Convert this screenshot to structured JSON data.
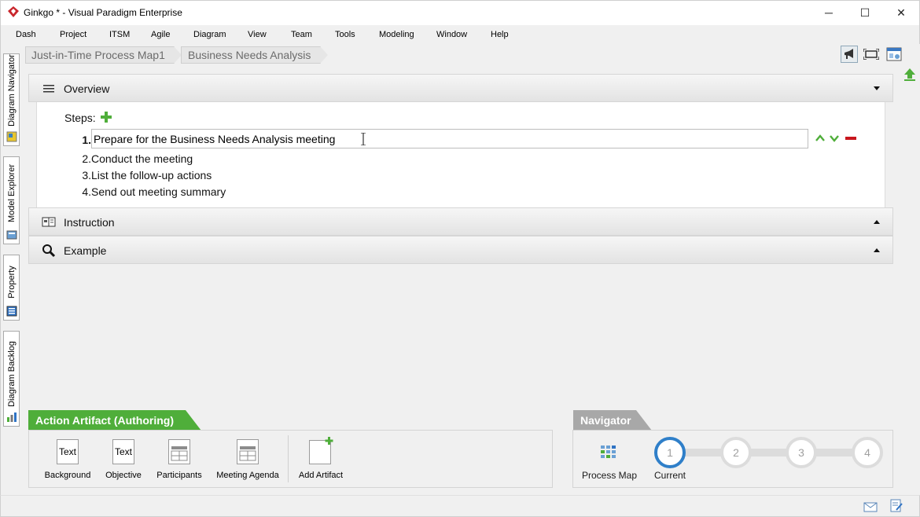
{
  "window": {
    "title": "Ginkgo * - Visual Paradigm Enterprise",
    "minimize": "─",
    "maximize": "☐",
    "close": "✕"
  },
  "menu": [
    "Dash",
    "Project",
    "ITSM",
    "Agile",
    "Diagram",
    "View",
    "Team",
    "Tools",
    "Modeling",
    "Window",
    "Help"
  ],
  "side_tabs": [
    "Diagram Navigator",
    "Model Explorer",
    "Property",
    "Diagram Backlog"
  ],
  "breadcrumb": [
    "Just-in-Time Process Map1",
    "Business Needs Analysis"
  ],
  "sections": {
    "overview": "Overview",
    "instruction": "Instruction",
    "example": "Example"
  },
  "steps": {
    "label": "Steps:",
    "items": [
      {
        "number": "1.",
        "text": "Prepare for the Business Needs Analysis meeting"
      },
      {
        "number": "2.",
        "text": "Conduct the meeting"
      },
      {
        "number": "3.",
        "text": "List the follow-up actions"
      },
      {
        "number": "4.",
        "text": "Send out meeting summary"
      }
    ]
  },
  "artifact_panel": {
    "title": "Action Artifact (Authoring)",
    "items": [
      {
        "label": "Background",
        "icon_text": "Text"
      },
      {
        "label": "Objective",
        "icon_text": "Text"
      },
      {
        "label": "Participants",
        "icon_text": ""
      },
      {
        "label": "Meeting Agenda",
        "icon_text": ""
      }
    ],
    "add_label": "Add Artifact"
  },
  "navigator": {
    "title": "Navigator",
    "process_map_label": "Process Map",
    "current_label": "Current",
    "steps": [
      "1",
      "2",
      "3",
      "4"
    ],
    "current_index": 0
  },
  "colors": {
    "accent_green": "#4fae3a",
    "navigator_gray": "#a8a8a8",
    "current_blue": "#2f7fc9",
    "remove_red": "#c8161d"
  }
}
